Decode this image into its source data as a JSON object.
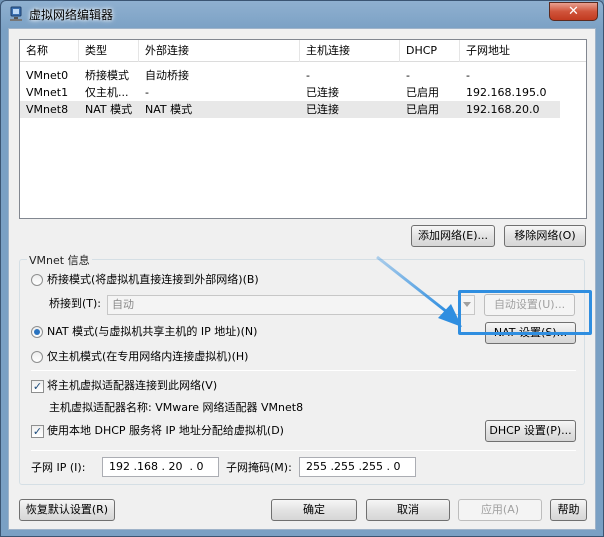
{
  "window": {
    "title": "虚拟网络编辑器",
    "close_glyph": "✕"
  },
  "network_list": {
    "columns": [
      "名称",
      "类型",
      "外部连接",
      "主机连接",
      "DHCP",
      "子网地址"
    ],
    "rows": [
      {
        "name": "VMnet0",
        "type": "桥接模式",
        "external": "自动桥接",
        "host": "-",
        "dhcp": "-",
        "subnet": "-"
      },
      {
        "name": "VMnet1",
        "type": "仅主机...",
        "external": "-",
        "host": "已连接",
        "dhcp": "已启用",
        "subnet": "192.168.195.0"
      },
      {
        "name": "VMnet8",
        "type": "NAT 模式",
        "external": "NAT 模式",
        "host": "已连接",
        "dhcp": "已启用",
        "subnet": "192.168.20.0"
      }
    ],
    "selected_row": 2
  },
  "list_buttons": {
    "add_network": "添加网络(E)...",
    "remove_network": "移除网络(O)"
  },
  "vmnet_info": {
    "group_label": "VMnet 信息",
    "bridged_label": "桥接模式(将虚拟机直接连接到外部网络)(B)",
    "bridged_to_label": "桥接到(T):",
    "bridged_to_value": "自动",
    "auto_settings": "自动设置(U)...",
    "nat_label": "NAT 模式(与虚拟机共享主机的 IP 地址)(N)",
    "nat_settings": "NAT 设置(S)...",
    "hostonly_label": "仅主机模式(在专用网络内连接虚拟机)(H)",
    "selected_mode": "nat",
    "connect_adapter_label": "将主机虚拟适配器连接到此网络(V)",
    "connect_adapter_checked": true,
    "adapter_name_label": "主机虚拟适配器名称: VMware 网络适配器 VMnet8",
    "dhcp_label": "使用本地 DHCP 服务将 IP 地址分配给虚拟机(D)",
    "dhcp_checked": true,
    "dhcp_settings": "DHCP 设置(P)...",
    "subnet_ip_label": "子网 IP (I):",
    "subnet_ip_value": "192 .168 . 20  . 0",
    "subnet_mask_label": "子网掩码(M):",
    "subnet_mask_value": "255 .255 .255 . 0"
  },
  "footer": {
    "restore_defaults": "恢复默认设置(R)",
    "ok": "确定",
    "cancel": "取消",
    "apply": "应用(A)",
    "help": "帮助"
  },
  "colors": {
    "annotation": "#2f8ee0",
    "selected_row": "#e8e8e8"
  }
}
